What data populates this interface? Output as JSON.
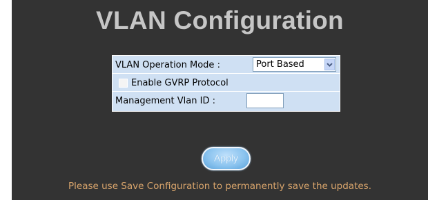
{
  "page": {
    "title": "VLAN Configuration"
  },
  "vlan_table": {
    "operation_mode_label": "VLAN Operation Mode :",
    "operation_mode_value": "Port Based",
    "gvrp_label": "Enable GVRP Protocol",
    "gvrp_checked": false,
    "management_vlan_label": "Management Vlan ID :",
    "management_vlan_value": ""
  },
  "actions": {
    "apply_label": "Apply"
  },
  "footer": {
    "save_note": "Please use Save Configuration to permanently save the updates."
  },
  "colors": {
    "background": "#333333",
    "title": "#c6c6c6",
    "table_background": "#cfe0f3",
    "note": "#d9a56c",
    "apply_button": "#8cc4ef"
  },
  "icons": {
    "dropdown": "chevron-down-icon"
  }
}
